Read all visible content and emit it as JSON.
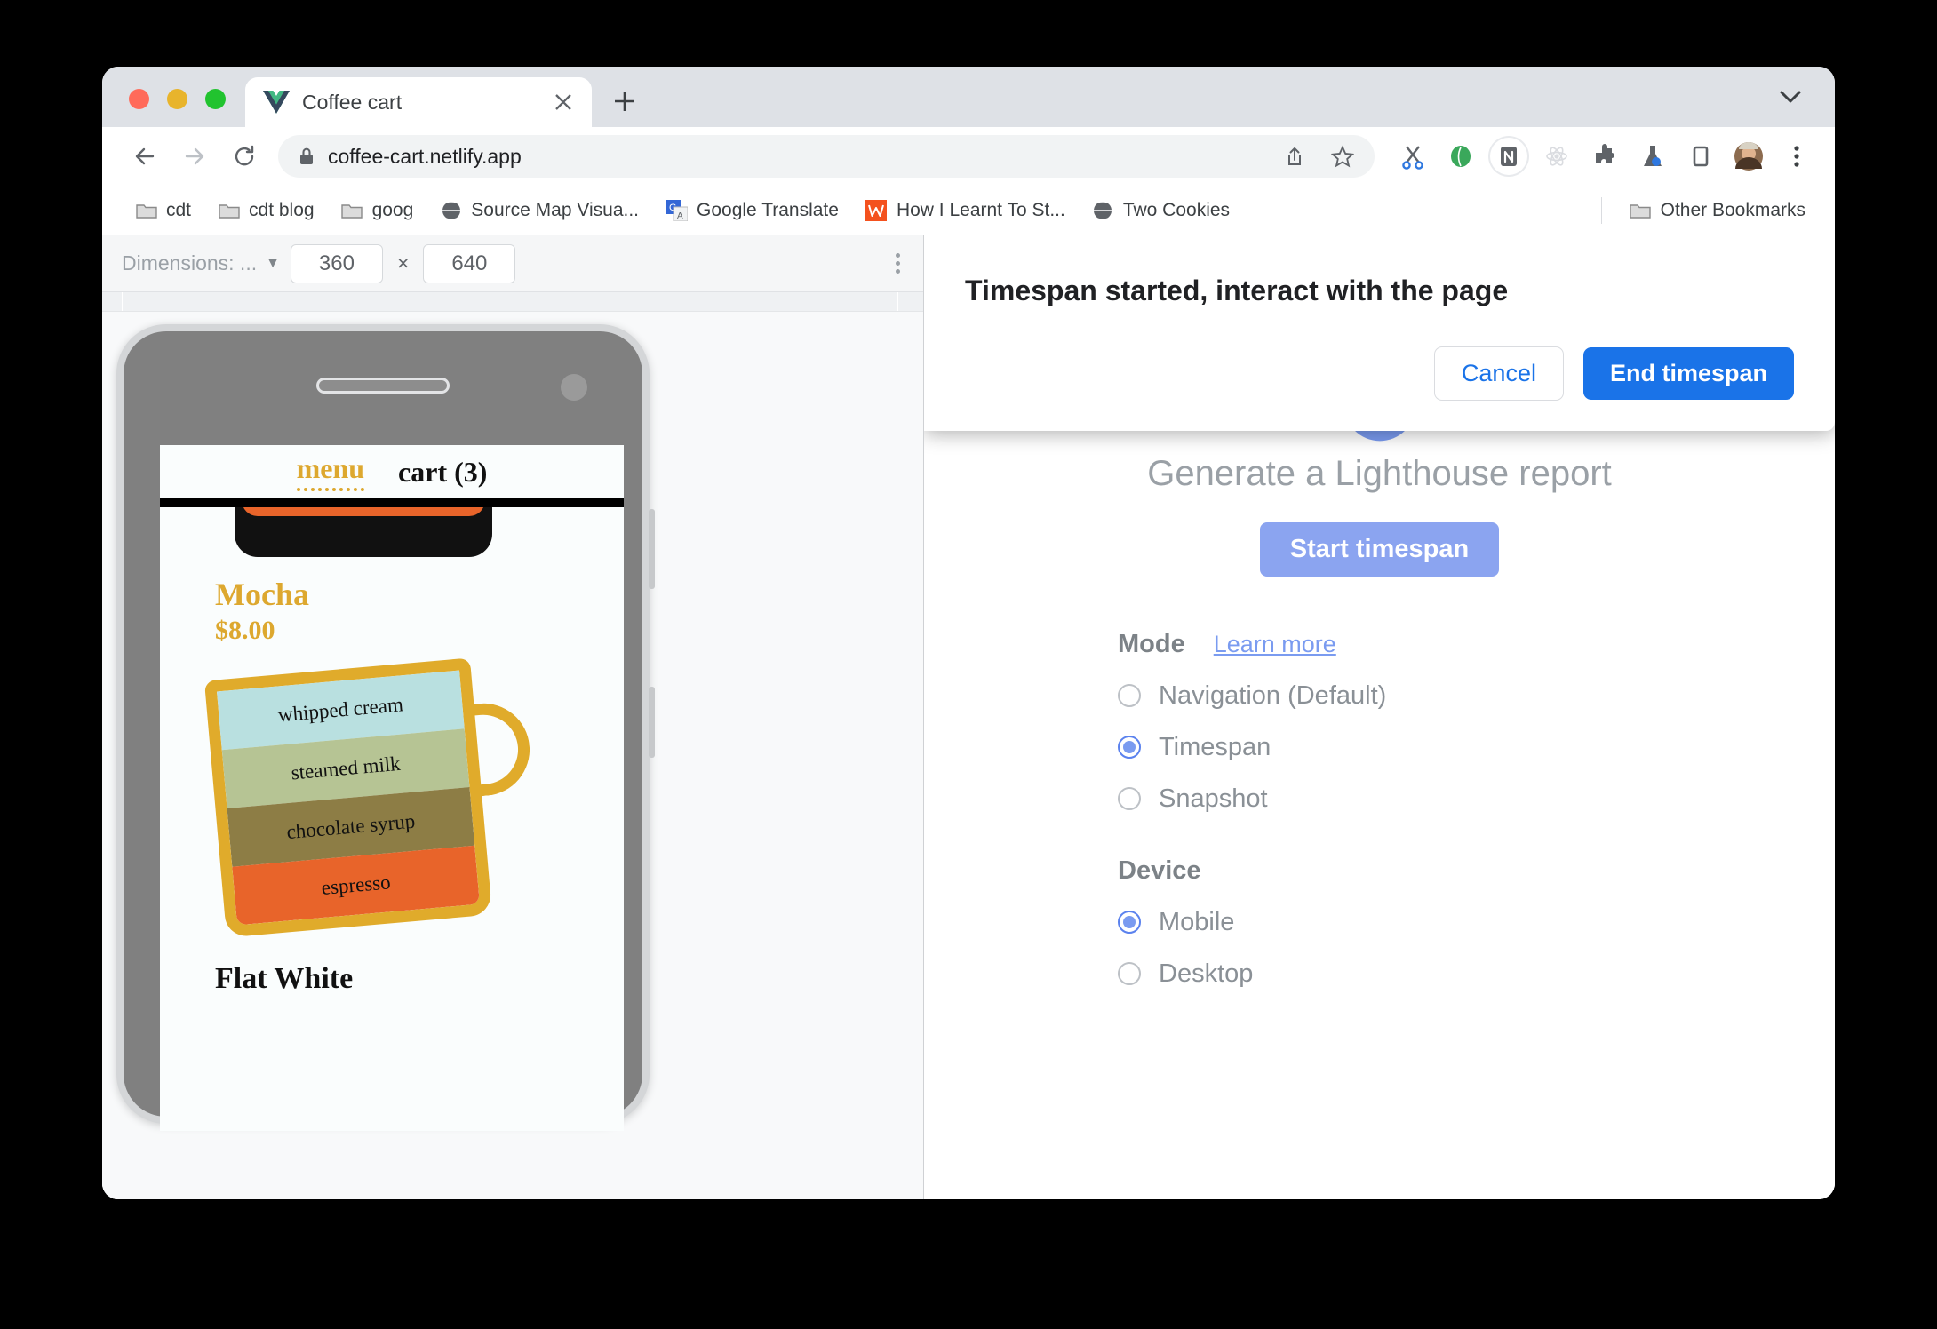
{
  "browser": {
    "tab": {
      "title": "Coffee cart",
      "favicon_name": "vue-logo-icon",
      "close_label": "×"
    },
    "new_tab_label": "+",
    "tab_search_name": "chevron-down-icon",
    "omnibox": {
      "url": "coffee-cart.netlify.app",
      "lock_name": "lock-icon",
      "share_name": "share-icon",
      "bookmark_name": "star-icon"
    },
    "nav": {
      "back": "←",
      "forward": "→",
      "reload": "↻"
    },
    "extensions": [
      {
        "name": "scissors-extension-icon",
        "glyph": "✂"
      },
      {
        "name": "green-leaf-extension-icon",
        "glyph": "●"
      },
      {
        "name": "notion-extension-icon",
        "glyph": "n"
      },
      {
        "name": "react-devtools-extension-icon",
        "glyph": "⚛"
      },
      {
        "name": "puzzle-extensions-icon",
        "glyph": "❖"
      },
      {
        "name": "lab-flask-extension-icon",
        "glyph": "⚗"
      },
      {
        "name": "side-panel-icon",
        "glyph": "▭"
      },
      {
        "name": "avatar",
        "glyph": "●"
      },
      {
        "name": "browser-menu-kebab-icon",
        "glyph": "⋮"
      }
    ],
    "bookmarks": [
      {
        "label": "cdt",
        "icon": "folder-icon"
      },
      {
        "label": "cdt blog",
        "icon": "folder-icon"
      },
      {
        "label": "goog",
        "icon": "folder-icon"
      },
      {
        "label": "Source Map Visua...",
        "icon": "globe-icon"
      },
      {
        "label": "Google Translate",
        "icon": "google-translate-icon"
      },
      {
        "label": "How I Learnt To St...",
        "icon": "wordpress-icon"
      },
      {
        "label": "Two Cookies",
        "icon": "globe-icon"
      }
    ],
    "other_bookmarks": {
      "label": "Other Bookmarks",
      "icon": "folder-icon"
    }
  },
  "device_toolbar": {
    "dimensions_label": "Dimensions: ...",
    "caret": "▼",
    "width": "360",
    "height": "640",
    "times": "×",
    "menu_name": "device-toolbar-kebab-icon"
  },
  "page": {
    "nav": {
      "menu": "menu",
      "cart": "cart (3)"
    },
    "product": {
      "name": "Mocha",
      "price": "$8.00",
      "layers": [
        {
          "label": "whipped cream",
          "color": "#b9e0e0"
        },
        {
          "label": "steamed milk",
          "color": "#b6c494"
        },
        {
          "label": "chocolate syrup",
          "color": "#8d7d45"
        },
        {
          "label": "espresso",
          "color": "#e8642a"
        }
      ]
    },
    "next_product": "Flat White",
    "colors": {
      "accent": "#dda82f",
      "mug_border": "#e0ab2b",
      "page_bg": "#fafdfd"
    }
  },
  "devtools": {
    "lighthouse": {
      "logo_name": "lighthouse-logo-icon",
      "title": "Generate a Lighthouse report",
      "start_button": "Start timespan",
      "mode": {
        "label": "Mode",
        "learn_more": "Learn more",
        "options": [
          {
            "label": "Navigation (Default)",
            "selected": false
          },
          {
            "label": "Timespan",
            "selected": true
          },
          {
            "label": "Snapshot",
            "selected": false
          }
        ]
      },
      "device": {
        "label": "Device",
        "options": [
          {
            "label": "Mobile",
            "selected": true
          },
          {
            "label": "Desktop",
            "selected": false
          }
        ]
      }
    },
    "dialog": {
      "title": "Timespan started, interact with the page",
      "cancel": "Cancel",
      "confirm": "End timespan"
    },
    "colors": {
      "primary": "#1a73e8",
      "link": "#7a9bf0",
      "disabled_button": "#8ba4f0"
    }
  }
}
